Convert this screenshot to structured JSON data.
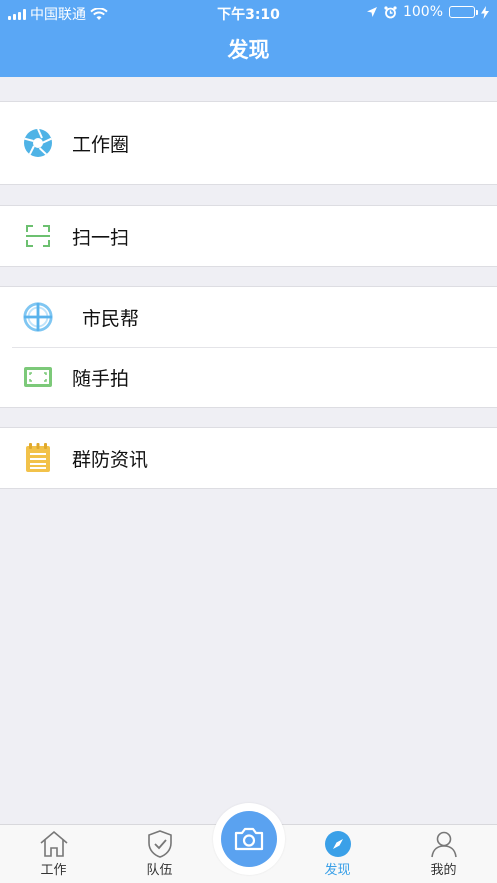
{
  "status_bar": {
    "carrier": "中国联通",
    "time": "下午3:10",
    "battery": "100%"
  },
  "nav": {
    "title": "发现"
  },
  "menu": {
    "work_circle": "工作圈",
    "scan": "扫一扫",
    "citizen_help": "市民帮",
    "snapshot": "随手拍",
    "defense_news": "群防资讯"
  },
  "tabbar": {
    "work": "工作",
    "team": "队伍",
    "discover": "发现",
    "mine": "我的"
  },
  "colors": {
    "brand": "#5aa7f5",
    "active_tab": "#3aa0e8",
    "scan_green": "#6cc070",
    "news_yellow": "#f2c24a"
  }
}
